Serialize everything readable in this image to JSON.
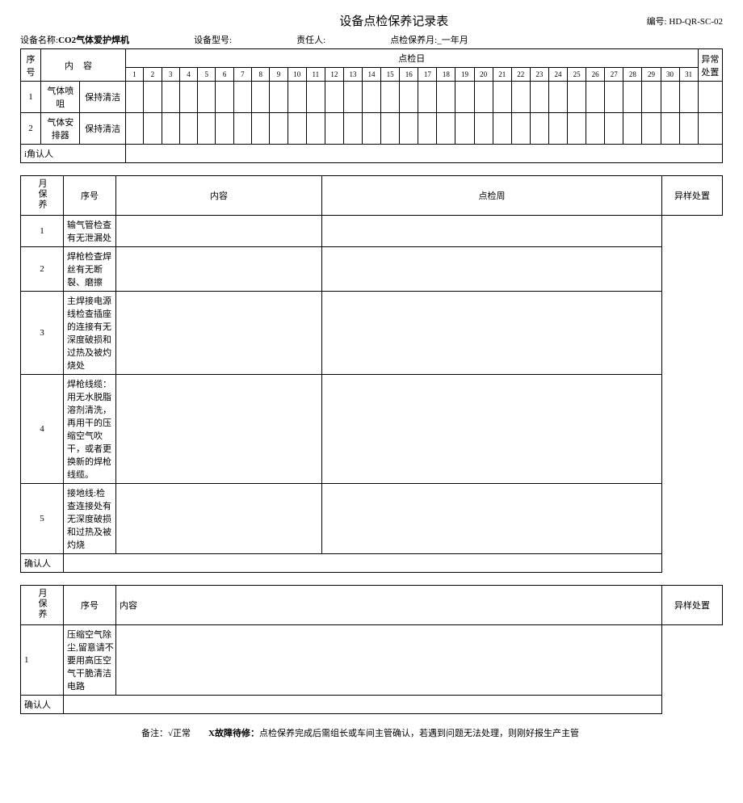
{
  "title": "设备点检保养记录表",
  "doc_no_label": "编号:",
  "doc_no": "HD-QR-SC-02",
  "device_name_label": "设备名称:",
  "device_name": "CO2气体爱护焊机",
  "device_model_label": "设备型号:",
  "responsible_label": "责任人:",
  "period_label": "点检保养月:",
  "period_value": "_一年月",
  "daily": {
    "seq": "序号",
    "content": "内容",
    "check_day": "点检日",
    "exception": "异常处置",
    "days": [
      "1",
      "2",
      "3",
      "4",
      "5",
      "6",
      "7",
      "8",
      "9",
      "10",
      "11",
      "12",
      "13",
      "14",
      "15",
      "16",
      "17",
      "18",
      "19",
      "20",
      "21",
      "22",
      "23",
      "24",
      "25",
      "26",
      "27",
      "28",
      "29",
      "30",
      "31"
    ],
    "rows": [
      {
        "no": "1",
        "item": "气体喷咀",
        "req": "保持清洁"
      },
      {
        "no": "2",
        "item": "气体安排器",
        "req": "保持清洁"
      }
    ],
    "confirm": "i角认人"
  },
  "monthly_label": "月保养",
  "monthly1": {
    "seq": "序号",
    "content": "内容",
    "check_week": "点检周",
    "exception": "异样处置",
    "rows": [
      {
        "no": "1",
        "content": "输气管检查有无泄漏处"
      },
      {
        "no": "2",
        "content": "焊枪检查焊丝有无断裂、磨擦"
      },
      {
        "no": "3",
        "content": "主焊接电源线检查插座的连接有无深度破损和过热及被灼烧处"
      },
      {
        "no": "4",
        "content": "焊枪线缆：用无水脱脂溶剂清洗，再用干的压缩空气吹干，或者更换新的焊枪线缆。"
      },
      {
        "no": "5",
        "content": "接地线:检查连接处有无深度破损和过热及被灼烧"
      }
    ],
    "confirm": "确认人"
  },
  "monthly2": {
    "seq": "序号",
    "content": "内容",
    "exception": "异样处置",
    "rows": [
      {
        "no": "1",
        "content": "压缩空气除尘,留意请不要用高压空气干脆清洁电路"
      }
    ],
    "confirm": "确认人"
  },
  "footer": {
    "prefix": "备注：√正常",
    "x": "X故障待修：",
    "rest": "点检保养完成后需组长或车间主管确认，若遇到问题无法处理，则刚好报生产主管"
  }
}
